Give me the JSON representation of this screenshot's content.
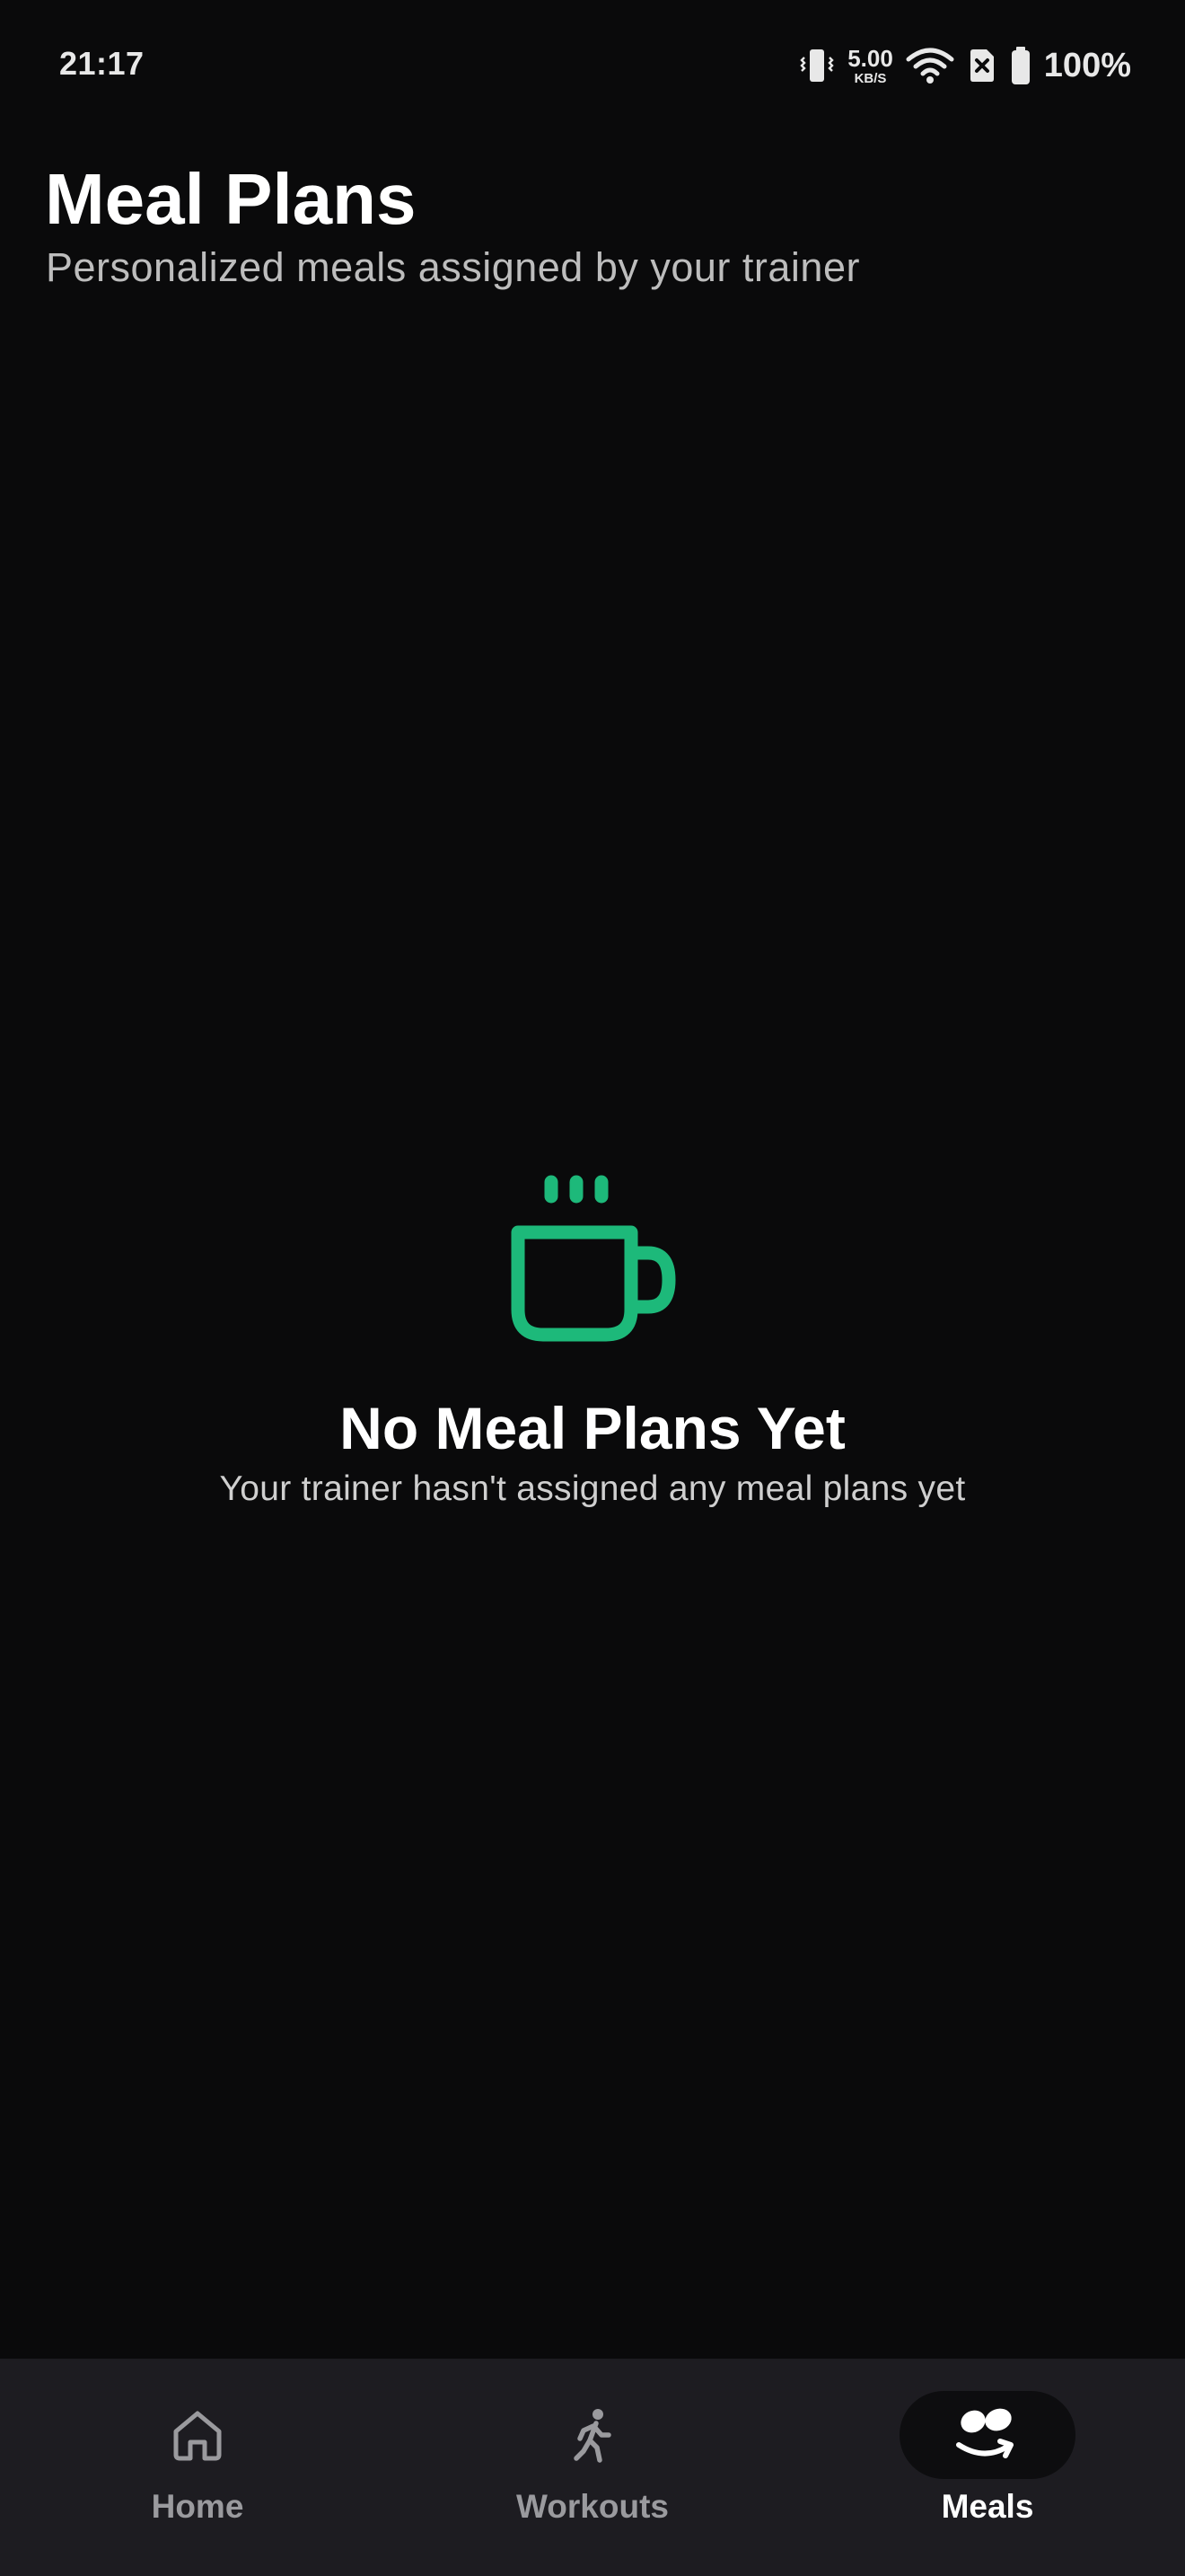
{
  "status_bar": {
    "time": "21:17",
    "net_speed": "5.00",
    "net_unit": "KB/S",
    "battery": "100%"
  },
  "header": {
    "title": "Meal Plans",
    "subtitle": "Personalized meals assigned by your trainer"
  },
  "empty_state": {
    "icon": "coffee-cup-icon",
    "title": "No Meal Plans Yet",
    "description": "Your trainer hasn't assigned any meal plans yet"
  },
  "colors": {
    "background": "#0a0a0b",
    "accent": "#1db97a",
    "nav_background": "#1d1c21"
  },
  "bottom_nav": {
    "active": "Meals",
    "items": [
      {
        "label": "Home",
        "icon": "home-icon"
      },
      {
        "label": "Workouts",
        "icon": "walking-icon"
      },
      {
        "label": "Meals",
        "icon": "meals-icon"
      }
    ]
  }
}
